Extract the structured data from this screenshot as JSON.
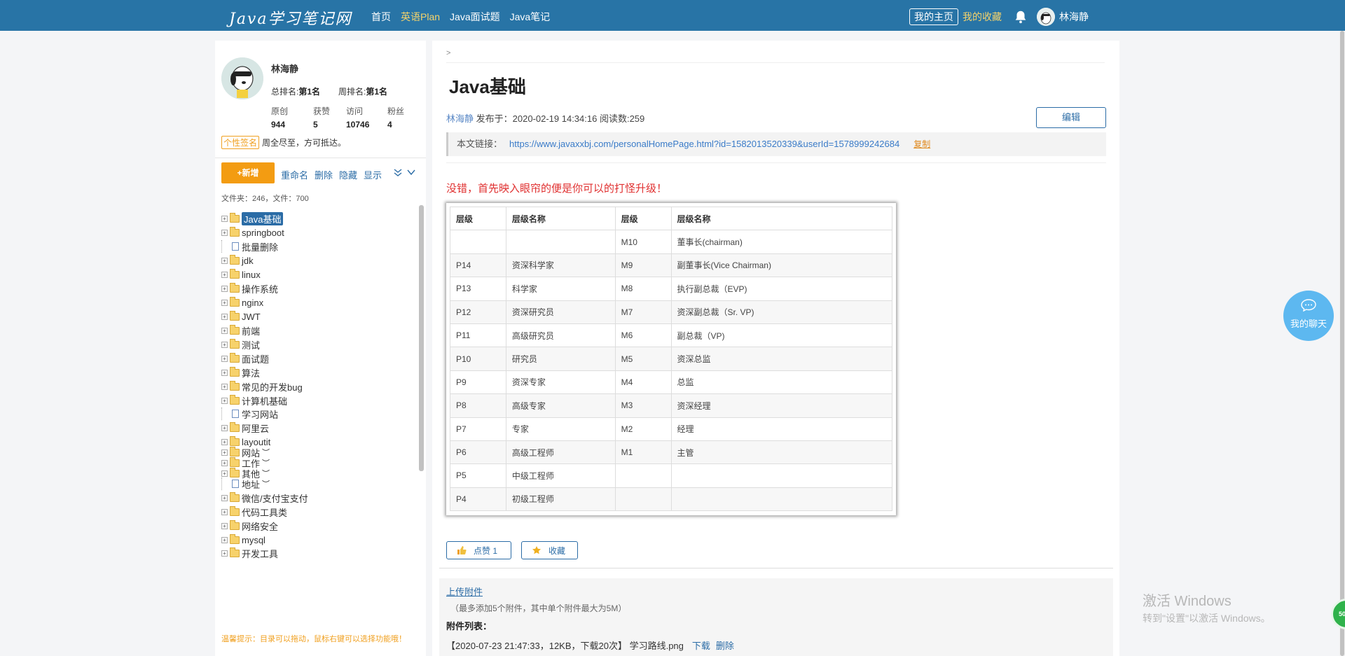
{
  "topbar": {
    "logo": "Java学习笔记网",
    "nav": [
      "首页",
      "英语Plan",
      "Java面试题",
      "Java笔记"
    ],
    "my_home": "我的主页",
    "my_fav": "我的收藏",
    "username": "林海静",
    "accent_color": "#2874a6"
  },
  "profile": {
    "name": "林海静",
    "total_rank_label": "总排名:",
    "total_rank_value": "第1名",
    "week_rank_label": "周排名:",
    "week_rank_value": "第1名",
    "stats": [
      {
        "label": "原创",
        "value": "944"
      },
      {
        "label": "获赞",
        "value": "5"
      },
      {
        "label": "访问",
        "value": "10746"
      },
      {
        "label": "粉丝",
        "value": "4"
      }
    ],
    "signature_label": "个性签名",
    "signature": "周全尽至，方可抵达。"
  },
  "sidebar": {
    "new_button": "+新增",
    "actions": [
      "重命名",
      "删除",
      "隐藏",
      "显示"
    ],
    "file_count": "文件夹：246，文件：700",
    "tree": [
      {
        "label": "Java基础",
        "type": "folder",
        "selected": true
      },
      {
        "label": "springboot",
        "type": "folder"
      },
      {
        "label": "批量删除",
        "type": "doc"
      },
      {
        "label": "jdk",
        "type": "folder"
      },
      {
        "label": "linux",
        "type": "folder"
      },
      {
        "label": "操作系统",
        "type": "folder"
      },
      {
        "label": "nginx",
        "type": "folder"
      },
      {
        "label": "JWT",
        "type": "folder"
      },
      {
        "label": "前端",
        "type": "folder"
      },
      {
        "label": "测试",
        "type": "folder"
      },
      {
        "label": "面试题",
        "type": "folder"
      },
      {
        "label": "算法",
        "type": "folder"
      },
      {
        "label": "常见的开发bug",
        "type": "folder"
      },
      {
        "label": "计算机基础",
        "type": "folder"
      },
      {
        "label": "学习网站",
        "type": "doc"
      },
      {
        "label": "阿里云",
        "type": "folder"
      },
      {
        "label": "layoutit",
        "type": "folder"
      },
      {
        "label": "网站",
        "type": "folder",
        "collapsed": true
      },
      {
        "label": "工作",
        "type": "folder",
        "collapsed": true
      },
      {
        "label": "其他",
        "type": "folder",
        "collapsed": true
      },
      {
        "label": "地址",
        "type": "doc",
        "collapsed": true
      },
      {
        "label": "微信/支付宝支付",
        "type": "folder"
      },
      {
        "label": "代码工具类",
        "type": "folder"
      },
      {
        "label": "网络安全",
        "type": "folder"
      },
      {
        "label": "mysql",
        "type": "folder"
      },
      {
        "label": "开发工具",
        "type": "folder"
      }
    ],
    "hint": "温馨提示：目录可以拖动，鼠标右键可以选择功能哦！"
  },
  "article": {
    "breadcrumb": ">",
    "title": "Java基础",
    "author": "林海静",
    "published": " 发布于：2020-02-19 14:34:16   阅读数:259",
    "edit_button": "编辑",
    "link_label": "本文链接：",
    "link_url": "https://www.javaxxbj.com/personalHomePage.html?id=1582013520339&userId=1578999242684",
    "copy": "复制",
    "intro": "没错，首先映入眼帘的便是你可以的打怪升级！",
    "table": {
      "headers": [
        "层级",
        "层级名称",
        "层级",
        "层级名称"
      ],
      "rows": [
        [
          "",
          "",
          "M10",
          "董事长(chairman)"
        ],
        [
          "P14",
          "资深科学家",
          "M9",
          "副董事长(Vice Chairman)"
        ],
        [
          "P13",
          "科学家",
          "M8",
          "执行副总裁（EVP)"
        ],
        [
          "P12",
          "资深研究员",
          "M7",
          "资深副总裁（Sr. VP)"
        ],
        [
          "P11",
          "高级研究员",
          "M6",
          "副总裁（VP)"
        ],
        [
          "P10",
          "研究员",
          "M5",
          "资深总监"
        ],
        [
          "P9",
          "资深专家",
          "M4",
          "总监"
        ],
        [
          "P8",
          "高级专家",
          "M3",
          "资深经理"
        ],
        [
          "P7",
          "专家",
          "M2",
          "经理"
        ],
        [
          "P6",
          "高级工程师",
          "M1",
          "主管"
        ],
        [
          "P5",
          "中级工程师",
          "",
          ""
        ],
        [
          "P4",
          "初级工程师",
          "",
          ""
        ]
      ]
    },
    "like_button": "点赞 1",
    "fav_button": "收藏"
  },
  "attachments": {
    "upload": "上传附件",
    "note": "（最多添加5个附件，其中单个附件最大为5M）",
    "list_title": "附件列表：",
    "item": "【2020-07-23 21:47:33，12KB，下载20次】 学习路线.png",
    "download": "下载",
    "delete": "删除"
  },
  "chat": {
    "label": "我的聊天"
  },
  "watermark": {
    "line1": "激活 Windows",
    "line2": "转到\"设置\"以激活 Windows。"
  },
  "badge": "50"
}
